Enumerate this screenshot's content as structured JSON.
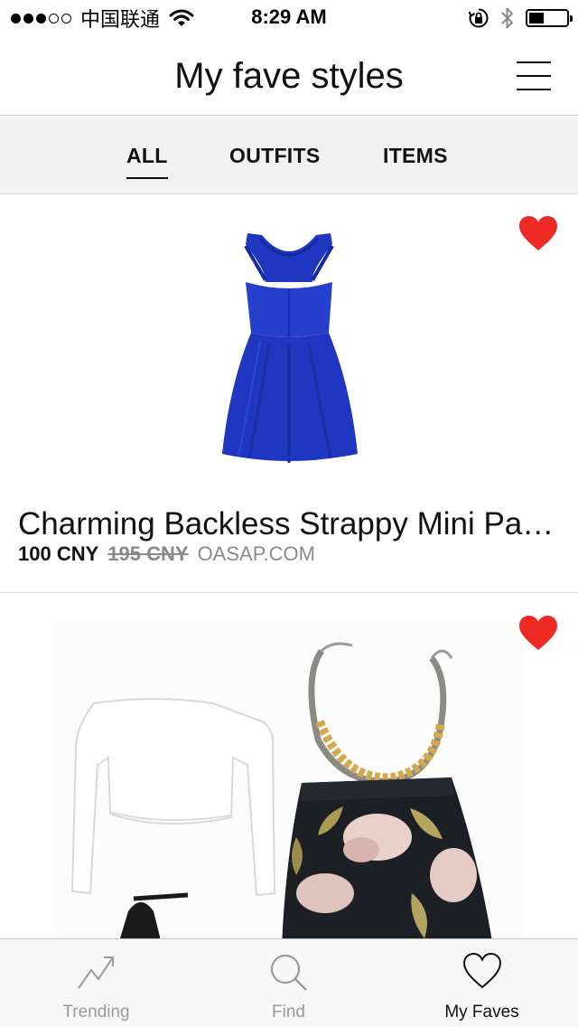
{
  "status_bar": {
    "carrier": "中国联通",
    "time": "8:29 AM",
    "signal_bars_filled": 3,
    "signal_bars_total": 5,
    "battery_level": 0.4
  },
  "header": {
    "title": "My fave styles",
    "menu_icon": "hamburger-menu-icon"
  },
  "filter_tabs": [
    {
      "label": "ALL",
      "active": true
    },
    {
      "label": "OUTFITS",
      "active": false
    },
    {
      "label": "ITEMS",
      "active": false
    }
  ],
  "items": [
    {
      "title": "Charming Backless Strappy Mini Pa…",
      "price": "100 CNY",
      "original_price": "195 CNY",
      "store": "OASAP.COM",
      "favorited": true,
      "image": "blue-dress"
    },
    {
      "favorited": true,
      "image": "outfit-collage"
    }
  ],
  "tab_bar": [
    {
      "label": "Trending",
      "icon": "trending-icon",
      "active": false
    },
    {
      "label": "Find",
      "icon": "search-icon",
      "active": false
    },
    {
      "label": "My Faves",
      "icon": "heart-outline-icon",
      "active": true
    }
  ],
  "colors": {
    "heart": "#ee2a24",
    "dress": "#1f37c0",
    "tab_background": "#f1f2f1"
  }
}
